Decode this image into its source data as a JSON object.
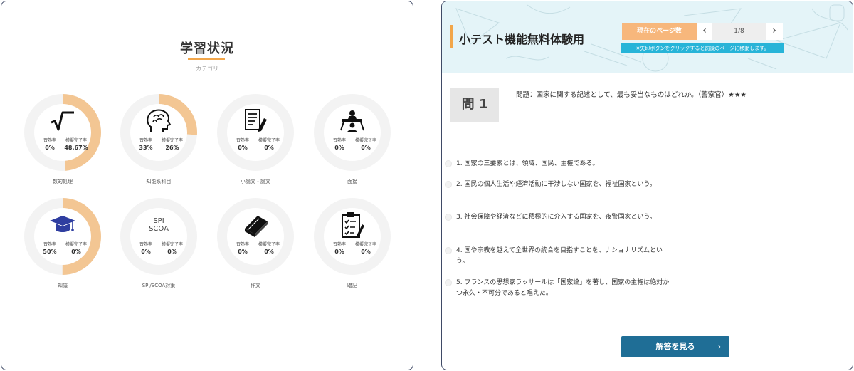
{
  "study_status": {
    "title": "学習状況",
    "subtitle": "カテゴリ",
    "categories": [
      {
        "name": "数的処理",
        "icon": "square-root-icon",
        "label1": "習熟率",
        "value1": "0%",
        "label2": "模擬完了率",
        "value2": "48.67%",
        "progress": 0.4867
      },
      {
        "name": "知能系科目",
        "icon": "brain-head-icon",
        "label1": "習熟率",
        "value1": "33%",
        "label2": "模擬完了率",
        "value2": "26%",
        "progress": 0.26
      },
      {
        "name": "小論文・論文",
        "icon": "document-pen-icon",
        "label1": "習熟率",
        "value1": "0%",
        "label2": "模擬完了率",
        "value2": "0%",
        "progress": 0
      },
      {
        "name": "面接",
        "icon": "interview-icon",
        "label1": "習熟率",
        "value1": "0%",
        "label2": "模擬完了率",
        "value2": "0%",
        "progress": 0
      },
      {
        "name": "知識",
        "icon": "graduation-cap-icon",
        "label1": "習熟率",
        "value1": "50%",
        "label2": "模擬完了率",
        "value2": "0%",
        "progress": 0.5
      },
      {
        "name": "SPI/SCOA対策",
        "icon": "spi-scoa-icon",
        "icon_text": "SPI\nSCOA",
        "label1": "習熟率",
        "value1": "0%",
        "label2": "模擬完了率",
        "value2": "0%",
        "progress": 0
      },
      {
        "name": "作文",
        "icon": "book-icon",
        "label1": "習熟率",
        "value1": "0%",
        "label2": "模擬完了率",
        "value2": "0%",
        "progress": 0
      },
      {
        "name": "暗記",
        "icon": "clipboard-checklist-icon",
        "label1": "習熟率",
        "value1": "0%",
        "label2": "模擬完了率",
        "value2": "0%",
        "progress": 0
      }
    ]
  },
  "quiz": {
    "title": "小テスト機能無料体験用",
    "page_label": "現在のページ数",
    "page_value": "1/8",
    "prev": "‹",
    "next": "›",
    "page_hint": "※矢印ボタンをクリックすると前後のページに移動します。",
    "question_number": "問 1",
    "question_text": "問題：国家に関する記述として、最も妥当なものはどれか。（警察官）★★★",
    "options": [
      "1. 国家の三要素とは、領域、国民、主権である。",
      "2. 国民の個人生活や経済活動に干渉しない国家を、福祉国家という。",
      "3. 社会保障や経済などに積極的に介入する国家を、夜警国家という。",
      "4. 国や宗教を越えて全世界の統合を目指すことを、ナショナリズムという。",
      "5. フランスの思想家ラッサールは「国家論」を著し、国家の主権は絶対かつ永久・不可分であると唱えた。"
    ],
    "answer_button": "解答を見る",
    "answer_arrow": "›"
  },
  "colors": {
    "ring_track": "#f3f3f3",
    "ring_progress": "#f3c693",
    "accent_orange": "#f2a64a",
    "hint_blue": "#27b4d8",
    "button_blue": "#1f6e96",
    "panel_border": "#3f4a66"
  }
}
